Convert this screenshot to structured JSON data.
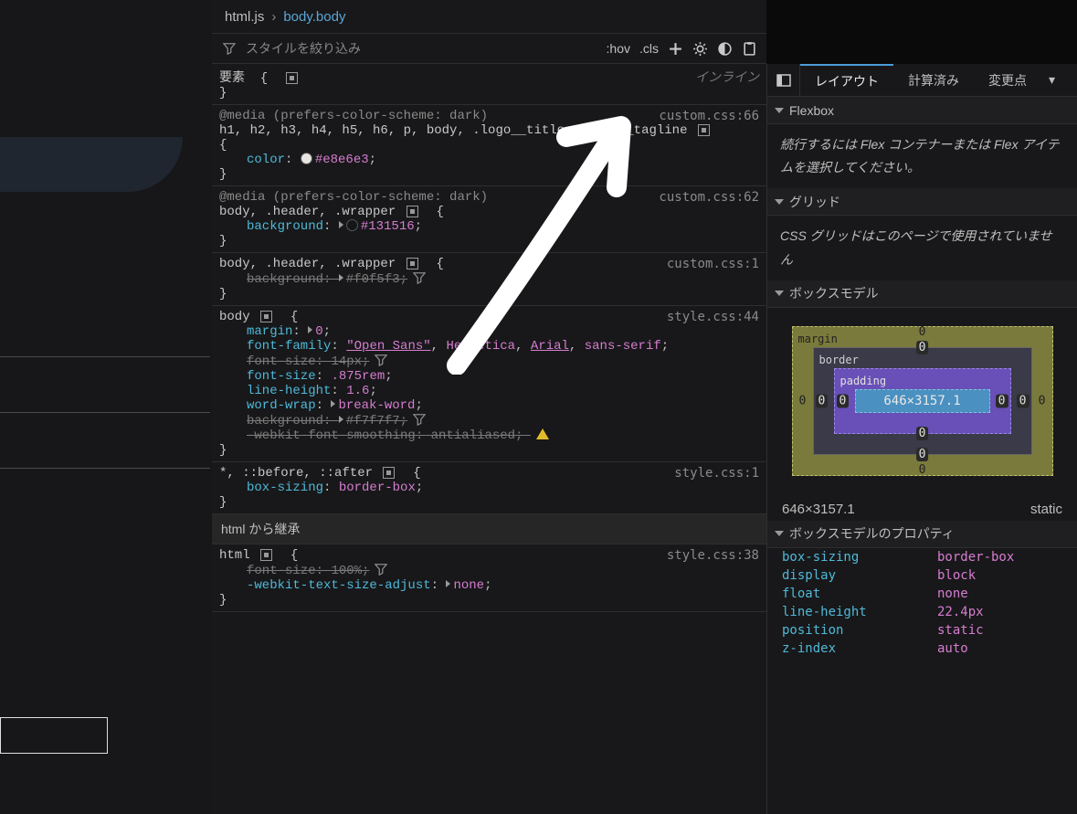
{
  "breadcrumb": {
    "file": "html.js",
    "selector": "body.body"
  },
  "toolbar": {
    "filter_placeholder": "スタイルを絞り込み",
    "hov": ":hov",
    "cls": ".cls"
  },
  "rules": {
    "element": {
      "selector": "要素",
      "inline_label": "インライン"
    },
    "media1": {
      "at": "@media (prefers-color-scheme: dark)",
      "source": "custom.css:66",
      "selector": "h1, h2, h3, h4, h5, h6, p, body, .logo__title, .logo__tagline",
      "color_prop": "color",
      "color_val": "#e8e6e3"
    },
    "media2": {
      "at": "@media (prefers-color-scheme: dark)",
      "source": "custom.css:62",
      "selector": "body, .header, .wrapper",
      "bg_prop": "background",
      "bg_val": "#131516"
    },
    "wrapper_over": {
      "source": "custom.css:1",
      "selector": "body, .header, .wrapper",
      "bg_prop": "background",
      "bg_val": "#f0f5f3"
    },
    "body": {
      "source": "style.css:44",
      "selector": "body",
      "margin_prop": "margin",
      "margin_val": "0",
      "ff_prop": "font-family",
      "ff_val1": "\"Open Sans\"",
      "ff_val2": "Helvetica",
      "ff_val3": "Arial",
      "ff_val4": "sans-serif",
      "fs_over_prop": "font-size",
      "fs_over_val": "14px",
      "fs_prop": "font-size",
      "fs_val": ".875rem",
      "lh_prop": "line-height",
      "lh_val": "1.6",
      "ww_prop": "word-wrap",
      "ww_val": "break-word",
      "bg_over_prop": "background",
      "bg_over_val": "#f7f7f7",
      "smooth_prop": "-webkit-font-smoothing",
      "smooth_val": "antialiased"
    },
    "reset": {
      "source": "style.css:1",
      "selector": "*, ::before, ::after",
      "bs_prop": "box-sizing",
      "bs_val": "border-box"
    },
    "inherit_label": "html から継承",
    "html": {
      "source": "style.css:38",
      "selector": "html",
      "fs_over_prop": "font-size",
      "fs_over_val": "100%",
      "tsa_prop": "-webkit-text-size-adjust",
      "tsa_val": "none"
    }
  },
  "right": {
    "tabs": {
      "layout": "レイアウト",
      "computed": "計算済み",
      "changes": "変更点"
    },
    "flexbox": {
      "title": "Flexbox",
      "msg": "続行するには Flex コンテナーまたは Flex アイテムを選択してください。"
    },
    "grid": {
      "title": "グリッド",
      "msg": "CSS グリッドはこのページで使用されていません"
    },
    "box_model": {
      "title": "ボックスモデル",
      "margin_label": "margin",
      "border_label": "border",
      "padding_label": "padding",
      "content": "646×3157.1",
      "zero": "0"
    },
    "dims": {
      "size": "646×3157.1",
      "pos": "static"
    },
    "props_title": "ボックスモデルのプロパティ",
    "props": {
      "box_sizing_k": "box-sizing",
      "box_sizing_v": "border-box",
      "display_k": "display",
      "display_v": "block",
      "float_k": "float",
      "float_v": "none",
      "line_height_k": "line-height",
      "line_height_v": "22.4px",
      "position_k": "position",
      "position_v": "static",
      "z_index_k": "z-index",
      "z_index_v": "auto"
    }
  }
}
